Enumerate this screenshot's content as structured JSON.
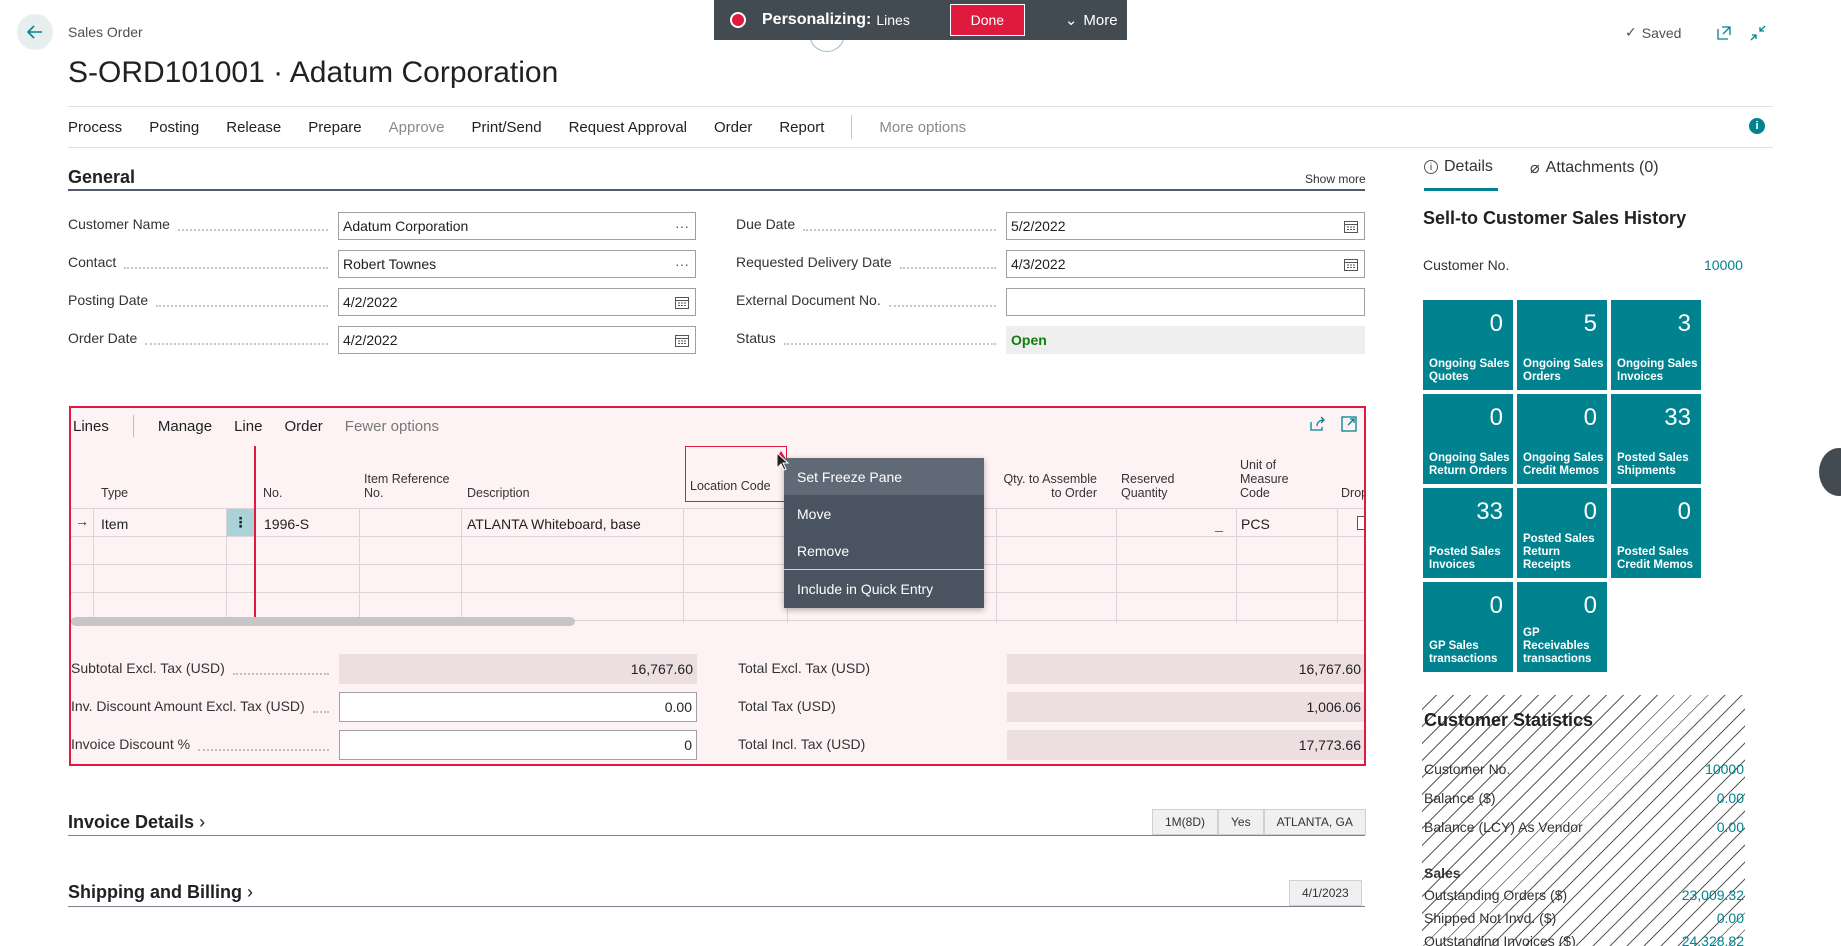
{
  "header": {
    "breadcrumb": "Sales Order",
    "title": "S-ORD101001 · Adatum Corporation",
    "saved": "Saved"
  },
  "personalize": {
    "label": "Personalizing:",
    "target": "Lines",
    "done": "Done",
    "more": "More"
  },
  "actions": [
    "Process",
    "Posting",
    "Release",
    "Prepare",
    "Approve",
    "Print/Send",
    "Request Approval",
    "Order",
    "Report"
  ],
  "more_options": "More options",
  "general": {
    "title": "General",
    "show_more": "Show more",
    "left": [
      {
        "label": "Customer Name",
        "value": "Adatum Corporation",
        "icon": "ellipsis-icon"
      },
      {
        "label": "Contact",
        "value": "Robert Townes",
        "icon": "ellipsis-icon"
      },
      {
        "label": "Posting Date",
        "value": "4/2/2022",
        "icon": "calendar-icon"
      },
      {
        "label": "Order Date",
        "value": "4/2/2022",
        "icon": "calendar-icon"
      }
    ],
    "right": [
      {
        "label": "Due Date",
        "value": "5/2/2022",
        "icon": "calendar-icon"
      },
      {
        "label": "Requested Delivery Date",
        "value": "4/3/2022",
        "icon": "calendar-icon"
      },
      {
        "label": "External Document No.",
        "value": "",
        "icon": ""
      },
      {
        "label": "Status",
        "value": "Open",
        "icon": ""
      }
    ]
  },
  "lines": {
    "title": "Lines",
    "menu": [
      "Manage",
      "Line",
      "Order"
    ],
    "fewer": "Fewer options",
    "columns": [
      "Type",
      "No.",
      "Item Reference No.",
      "Description",
      "Location Code",
      "Qty. to Assemble to Order",
      "Reserved Quantity",
      "Unit of Measure Code",
      "Drop Ship"
    ],
    "row": {
      "type": "Item",
      "no": "1996-S",
      "description": "ATLANTA Whiteboard, base",
      "reserved": "_",
      "uom": "PCS"
    }
  },
  "context_menu": [
    "Set Freeze Pane",
    "Move",
    "Remove",
    "Include in Quick Entry"
  ],
  "totals": {
    "left": [
      {
        "label": "Subtotal Excl. Tax (USD)",
        "value": "16,767.60"
      },
      {
        "label": "Inv. Discount Amount Excl. Tax (USD)",
        "value": "0.00"
      },
      {
        "label": "Invoice Discount %",
        "value": "0"
      }
    ],
    "right": [
      {
        "label": "Total Excl. Tax (USD)",
        "value": "16,767.60"
      },
      {
        "label": "Total Tax (USD)",
        "value": "1,006.06"
      },
      {
        "label": "Total Incl. Tax (USD)",
        "value": "17,773.66"
      }
    ]
  },
  "invoice_details": {
    "title": "Invoice Details",
    "chips": [
      "1M(8D)",
      "Yes",
      "ATLANTA, GA"
    ]
  },
  "shipping": {
    "title": "Shipping and Billing",
    "chips": [
      "4/1/2023"
    ]
  },
  "factbox": {
    "tabs": [
      "Details",
      "Attachments (0)"
    ],
    "title": "Sell-to Customer Sales History",
    "customer_no_label": "Customer No.",
    "customer_no": "10000",
    "tiles": [
      {
        "value": "0",
        "label": "Ongoing Sales Quotes"
      },
      {
        "value": "5",
        "label": "Ongoing Sales Orders"
      },
      {
        "value": "3",
        "label": "Ongoing Sales Invoices"
      },
      {
        "value": "0",
        "label": "Ongoing Sales Return Orders"
      },
      {
        "value": "0",
        "label": "Ongoing Sales Credit Memos"
      },
      {
        "value": "33",
        "label": "Posted Sales Shipments"
      },
      {
        "value": "33",
        "label": "Posted Sales Invoices"
      },
      {
        "value": "0",
        "label": "Posted Sales Return Receipts"
      },
      {
        "value": "0",
        "label": "Posted Sales Credit Memos"
      },
      {
        "value": "0",
        "label": "GP Sales transactions"
      },
      {
        "value": "0",
        "label": "GP Receivables transactions"
      }
    ],
    "stats": {
      "title": "Customer Statistics",
      "rows": [
        {
          "label": "Customer No.",
          "value": "10000"
        },
        {
          "label": "Balance ($)",
          "value": "0.00"
        },
        {
          "label": "Balance (LCY) As Vendor",
          "value": "0.00"
        }
      ],
      "sales_heading": "Sales",
      "sales_rows": [
        {
          "label": "Outstanding Orders ($)",
          "value": "23,009.32"
        },
        {
          "label": "Shipped Not Invd. ($)",
          "value": "0.00"
        },
        {
          "label": "Outstanding Invoices ($)",
          "value": "24,328.82"
        }
      ]
    }
  },
  "colors": {
    "accent": "#00838f",
    "personalize_red": "#e0193f",
    "dark_bar": "#424a52"
  }
}
